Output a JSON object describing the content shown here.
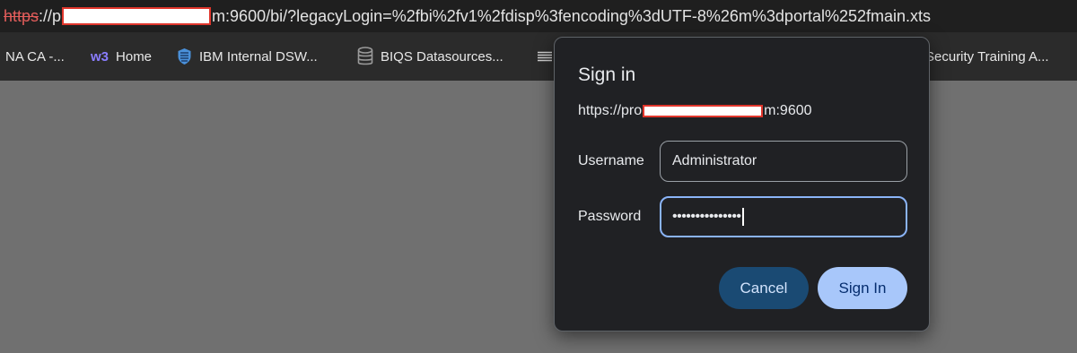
{
  "url": {
    "scheme": "https",
    "after_scheme": "://p",
    "rest": "m:9600/bi/?legacyLogin=%2fbi%2fv1%2fdisp%3fencoding%3dUTF-8%26m%3dportal%252fmain.xts"
  },
  "bookmarks": [
    {
      "label": "NA CA -...",
      "icon": ""
    },
    {
      "label": "Home",
      "icon": "w3"
    },
    {
      "label": "IBM Internal DSW...",
      "icon": "shield-icon"
    },
    {
      "label": "BIQS Datasources...",
      "icon": "database-icon"
    },
    {
      "label": "Security Training A...",
      "icon": ""
    }
  ],
  "dialog": {
    "title": "Sign in",
    "origin_prefix": "https://pro",
    "origin_suffix": "m:9600",
    "username_label": "Username",
    "username_value": "Administrator",
    "password_label": "Password",
    "password_value": "•••••••••••••••",
    "cancel_label": "Cancel",
    "signin_label": "Sign In"
  },
  "colors": {
    "dialog_bg": "#202124",
    "focus_border": "#8ab4f8",
    "signin_button": "#a8c7fa",
    "cancel_button": "#1a4a73"
  }
}
